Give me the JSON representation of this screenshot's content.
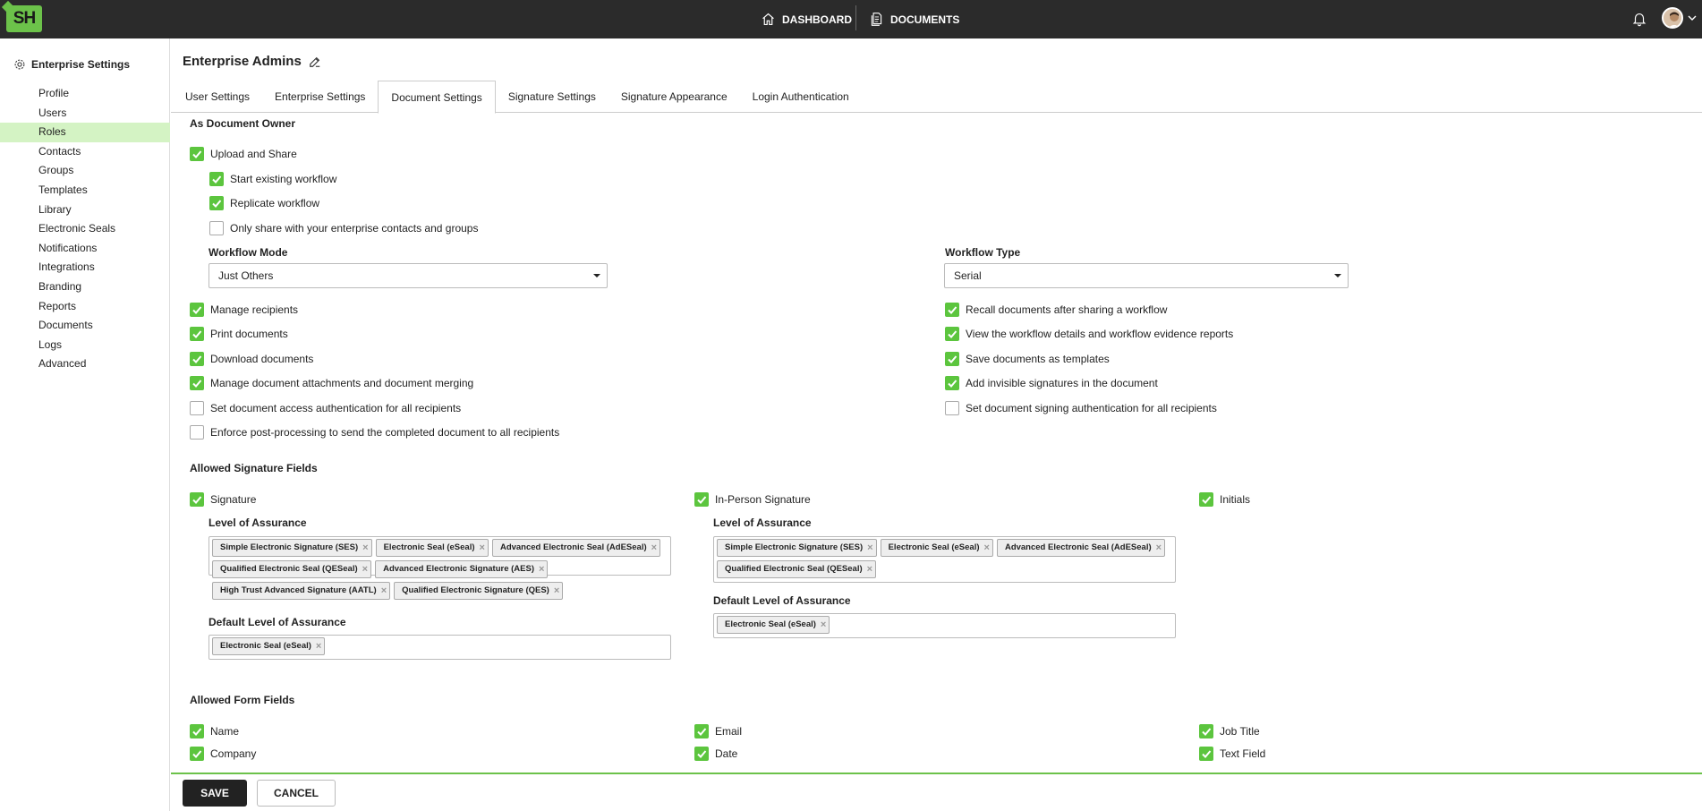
{
  "app": {
    "logo_text": "SH",
    "brand_color": "#6cc24a",
    "accent_check_color": "#5cc53e"
  },
  "topnav": {
    "dashboard": "DASHBOARD",
    "documents": "DOCUMENTS"
  },
  "sidebar": {
    "title": "Enterprise Settings",
    "items": [
      {
        "label": "Profile"
      },
      {
        "label": "Users"
      },
      {
        "label": "Roles"
      },
      {
        "label": "Contacts"
      },
      {
        "label": "Groups"
      },
      {
        "label": "Templates"
      },
      {
        "label": "Library"
      },
      {
        "label": "Electronic Seals"
      },
      {
        "label": "Notifications"
      },
      {
        "label": "Integrations"
      },
      {
        "label": "Branding"
      },
      {
        "label": "Reports"
      },
      {
        "label": "Documents"
      },
      {
        "label": "Logs"
      },
      {
        "label": "Advanced"
      }
    ],
    "active": "Roles"
  },
  "page": {
    "title": "Enterprise Admins"
  },
  "tabs": [
    {
      "label": "User Settings"
    },
    {
      "label": "Enterprise Settings"
    },
    {
      "label": "Document Settings"
    },
    {
      "label": "Signature Settings"
    },
    {
      "label": "Signature Appearance"
    },
    {
      "label": "Login Authentication"
    }
  ],
  "active_tab": "Document Settings",
  "owner": {
    "heading": "As Document Owner",
    "upload_share": {
      "label": "Upload and Share",
      "checked": true
    },
    "start_workflow": {
      "label": "Start existing workflow",
      "checked": true
    },
    "replicate": {
      "label": "Replicate workflow",
      "checked": true
    },
    "only_share": {
      "label": "Only share with your enterprise contacts and groups",
      "checked": false
    },
    "workflow_mode": {
      "label": "Workflow Mode",
      "value": "Just Others"
    },
    "workflow_type": {
      "label": "Workflow Type",
      "value": "Serial"
    },
    "left": [
      {
        "label": "Manage recipients",
        "checked": true
      },
      {
        "label": "Print documents",
        "checked": true
      },
      {
        "label": "Download documents",
        "checked": true
      },
      {
        "label": "Manage document attachments and document merging",
        "checked": true
      },
      {
        "label": "Set document access authentication for all recipients",
        "checked": false
      },
      {
        "label": "Enforce post-processing to send the completed document to all recipients",
        "checked": false
      }
    ],
    "right": [
      {
        "label": "Recall documents after sharing a workflow",
        "checked": true
      },
      {
        "label": "View the workflow details and workflow evidence reports",
        "checked": true
      },
      {
        "label": "Save documents as templates",
        "checked": true
      },
      {
        "label": "Add invisible signatures in the document",
        "checked": true
      },
      {
        "label": "Set document signing authentication for all recipients",
        "checked": false
      }
    ]
  },
  "sig_fields": {
    "heading": "Allowed Signature Fields",
    "signature": {
      "label": "Signature",
      "checked": true
    },
    "in_person": {
      "label": "In-Person Signature",
      "checked": true
    },
    "initials": {
      "label": "Initials",
      "checked": true
    },
    "loa_label": "Level of Assurance",
    "default_loa_label": "Default Level of Assurance",
    "signature_loa": [
      "Simple Electronic Signature (SES)",
      "Electronic Seal (eSeal)",
      "Advanced Electronic Seal (AdESeal)",
      "Qualified Electronic Seal (QESeal)",
      "Advanced Electronic Signature (AES)",
      "High Trust Advanced Signature (AATL)",
      "Qualified Electronic Signature (QES)"
    ],
    "signature_default": [
      "Electronic Seal (eSeal)"
    ],
    "in_person_loa": [
      "Simple Electronic Signature (SES)",
      "Electronic Seal (eSeal)",
      "Advanced Electronic Seal (AdESeal)",
      "Qualified Electronic Seal (QESeal)"
    ],
    "in_person_default": [
      "Electronic Seal (eSeal)"
    ]
  },
  "form_fields": {
    "heading": "Allowed Form Fields",
    "items": [
      {
        "label": "Name",
        "checked": true
      },
      {
        "label": "Email",
        "checked": true
      },
      {
        "label": "Job Title",
        "checked": true
      },
      {
        "label": "Company",
        "checked": true
      },
      {
        "label": "Date",
        "checked": true
      },
      {
        "label": "Text Field",
        "checked": true
      }
    ]
  },
  "footer": {
    "save": "SAVE",
    "cancel": "CANCEL"
  }
}
